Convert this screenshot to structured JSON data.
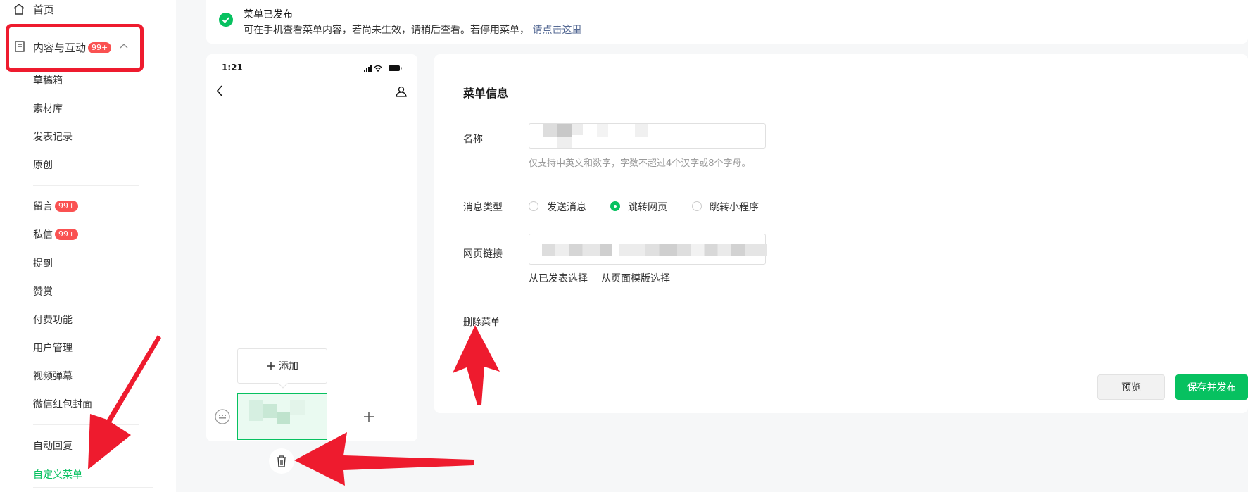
{
  "sidebar": {
    "home": "首页",
    "content_group": "内容与互动",
    "content_badge": "99+",
    "items": [
      "草稿箱",
      "素材库",
      "发表记录",
      "原创"
    ],
    "messages": "留言",
    "messages_badge": "99+",
    "private_msg": "私信",
    "private_msg_badge": "99+",
    "items2": [
      "提到",
      "赞赏",
      "付费功能",
      "用户管理",
      "视频弹幕",
      "微信红包封面"
    ],
    "auto_reply": "自动回复",
    "custom_menu": "自定义菜单"
  },
  "notice": {
    "title": "菜单已发布",
    "desc": "可在手机查看菜单内容，若尚未生效，请稍后查看。若停用菜单，",
    "link": "请点击这里"
  },
  "phone": {
    "time": "1:21",
    "add_label": "添加"
  },
  "form": {
    "section_title": "菜单信息",
    "name_label": "名称",
    "name_hint": "仅支持中英文和数字，字数不超过4个汉字或8个字母。",
    "msg_type_label": "消息类型",
    "options": [
      "发送消息",
      "跳转网页",
      "跳转小程序"
    ],
    "selected_option": "跳转网页",
    "url_label": "网页链接",
    "pick_published": "从已发表选择",
    "pick_template": "从页面模版选择",
    "delete_menu": "删除菜单"
  },
  "footer": {
    "preview": "预览",
    "save_publish": "保存并发布"
  },
  "colors": {
    "accent": "#07c160",
    "badge": "#fa5151",
    "link": "#576b95",
    "annotation": "#ee1b2e"
  }
}
